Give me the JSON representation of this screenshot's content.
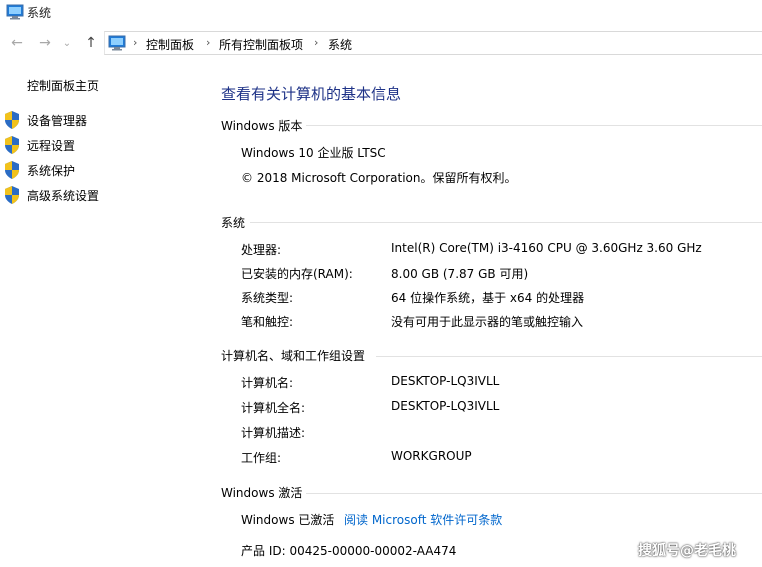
{
  "window": {
    "title": "系统"
  },
  "nav": {
    "back": "←",
    "forward": "→",
    "recent": "⌄",
    "up": "↑",
    "breadcrumb": [
      "控制面板",
      "所有控制面板项",
      "系统"
    ],
    "separator": "›"
  },
  "sidebar": {
    "home": "控制面板主页",
    "items": [
      {
        "label": "设备管理器",
        "icon": "uac-shield-icon"
      },
      {
        "label": "远程设置",
        "icon": "uac-shield-icon"
      },
      {
        "label": "系统保护",
        "icon": "uac-shield-icon"
      },
      {
        "label": "高级系统设置",
        "icon": "uac-shield-icon"
      }
    ]
  },
  "main": {
    "title": "查看有关计算机的基本信息",
    "edition": {
      "heading": "Windows 版本",
      "name": "Windows 10 企业版 LTSC",
      "copyright": "© 2018 Microsoft Corporation。保留所有权利。"
    },
    "system": {
      "heading": "系统",
      "rows": [
        {
          "label": "处理器:",
          "value": "Intel(R) Core(TM) i3-4160 CPU @ 3.60GHz   3.60 GHz"
        },
        {
          "label": "已安装的内存(RAM):",
          "value": "8.00 GB (7.87 GB 可用)"
        },
        {
          "label": "系统类型:",
          "value": "64 位操作系统，基于 x64 的处理器"
        },
        {
          "label": "笔和触控:",
          "value": "没有可用于此显示器的笔或触控输入"
        }
      ]
    },
    "computer": {
      "heading": "计算机名、域和工作组设置",
      "rows": [
        {
          "label": "计算机名:",
          "value": "DESKTOP-LQ3IVLL"
        },
        {
          "label": "计算机全名:",
          "value": "DESKTOP-LQ3IVLL"
        },
        {
          "label": "计算机描述:",
          "value": ""
        },
        {
          "label": "工作组:",
          "value": "WORKGROUP"
        }
      ]
    },
    "activation": {
      "heading": "Windows 激活",
      "status": "Windows 已激活",
      "license_link": "阅读 Microsoft 软件许可条款",
      "product_id": "产品 ID: 00425-00000-00002-AA474"
    }
  },
  "watermark": "搜狐号@老毛桃",
  "colors": {
    "title": "#1e3287",
    "link": "#0066cc",
    "rule": "#e2e2e2",
    "shield_blue": "#2b6cc4",
    "shield_yellow": "#f2c21b"
  }
}
